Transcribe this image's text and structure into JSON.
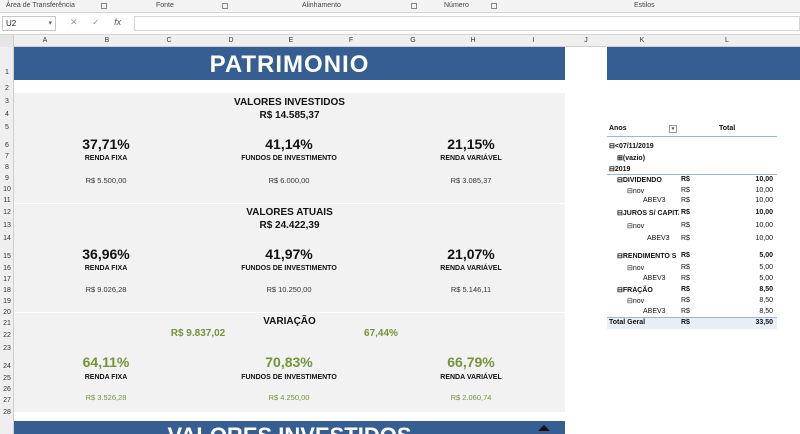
{
  "ribbon": {
    "groups": [
      "Área de Transferência",
      "Fonte",
      "Alinhamento",
      "Número",
      "Estilos"
    ]
  },
  "formula_bar": {
    "name_box": "U2",
    "cancel_icon": "✕",
    "enter_icon": "✓",
    "fx_icon": "fx"
  },
  "columns": [
    "A",
    "B",
    "C",
    "D",
    "E",
    "F",
    "G",
    "H",
    "I",
    "J",
    "K",
    "L"
  ],
  "rows": [
    "1",
    "2",
    "3",
    "4",
    "5",
    "6",
    "7",
    "8",
    "9",
    "10",
    "11",
    "12",
    "13",
    "14",
    "15",
    "16",
    "17",
    "18",
    "19",
    "20",
    "21",
    "22",
    "23",
    "24",
    "25",
    "26",
    "27",
    "28"
  ],
  "title": "PATRIMONIO",
  "investidos": {
    "title": "VALORES INVESTIDOS",
    "total": "R$ 14.585,37",
    "items": [
      {
        "pct": "37,71%",
        "label": "RENDA FIXA",
        "amount": "R$ 5.500,00"
      },
      {
        "pct": "41,14%",
        "label": "FUNDOS DE INVESTIMENTO",
        "amount": "R$ 6.000,00"
      },
      {
        "pct": "21,15%",
        "label": "RENDA VARIÁVEL",
        "amount": "R$ 3.085,37"
      }
    ]
  },
  "atuais": {
    "title": "VALORES ATUAIS",
    "total": "R$ 24.422,39",
    "items": [
      {
        "pct": "36,96%",
        "label": "RENDA FIXA",
        "amount": "R$ 9.026,28"
      },
      {
        "pct": "41,97%",
        "label": "FUNDOS DE INVESTIMENTO",
        "amount": "R$ 10.250,00"
      },
      {
        "pct": "21,07%",
        "label": "RENDA VARIÁVEL",
        "amount": "R$ 5.146,11"
      }
    ]
  },
  "variacao": {
    "title": "VARIAÇÃO",
    "total": "R$ 9.837,02",
    "total_pct": "67,44%",
    "items": [
      {
        "pct": "64,11%",
        "label": "RENDA FIXA",
        "amount": "R$ 3.526,28"
      },
      {
        "pct": "70,83%",
        "label": "FUNDOS DE INVESTIMENTO",
        "amount": "R$ 4.250,00"
      },
      {
        "pct": "66,79%",
        "label": "RENDA VARIÁVEL",
        "amount": "R$ 2.060,74"
      }
    ]
  },
  "bottom_title": "VALORES INVESTIDOS",
  "pivot": {
    "header_anos": "Anos",
    "header_total": "Total",
    "rows": [
      {
        "label": "⊟<07/11/2019",
        "cur": "",
        "val": ""
      },
      {
        "label": "⊞(vazio)",
        "cur": "",
        "val": ""
      },
      {
        "label": "⊟2019",
        "cur": "",
        "val": ""
      },
      {
        "label": "⊟DIVIDENDO",
        "cur": "R$",
        "val": "10,00"
      },
      {
        "label": "⊟nov",
        "cur": "R$",
        "val": "10,00"
      },
      {
        "label": "ABEV3",
        "cur": "R$",
        "val": "10,00"
      },
      {
        "label": "⊟JUROS S/ CAPITAL",
        "cur": "R$",
        "val": "10,00"
      },
      {
        "label": "⊟nov",
        "cur": "R$",
        "val": "10,00"
      },
      {
        "label": "ABEV3",
        "cur": "R$",
        "val": "10,00"
      },
      {
        "label": "⊟RENDIMENTO S",
        "cur": "R$",
        "val": "5,00"
      },
      {
        "label": "⊟nov",
        "cur": "R$",
        "val": "5,00"
      },
      {
        "label": "ABEV3",
        "cur": "R$",
        "val": "5,00"
      },
      {
        "label": "⊟FRAÇÃO",
        "cur": "R$",
        "val": "8,50"
      },
      {
        "label": "⊟nov",
        "cur": "R$",
        "val": "8,50"
      },
      {
        "label": "ABEV3",
        "cur": "R$",
        "val": "8,50"
      },
      {
        "label": "Total Geral",
        "cur": "R$",
        "val": "33,50"
      }
    ]
  }
}
